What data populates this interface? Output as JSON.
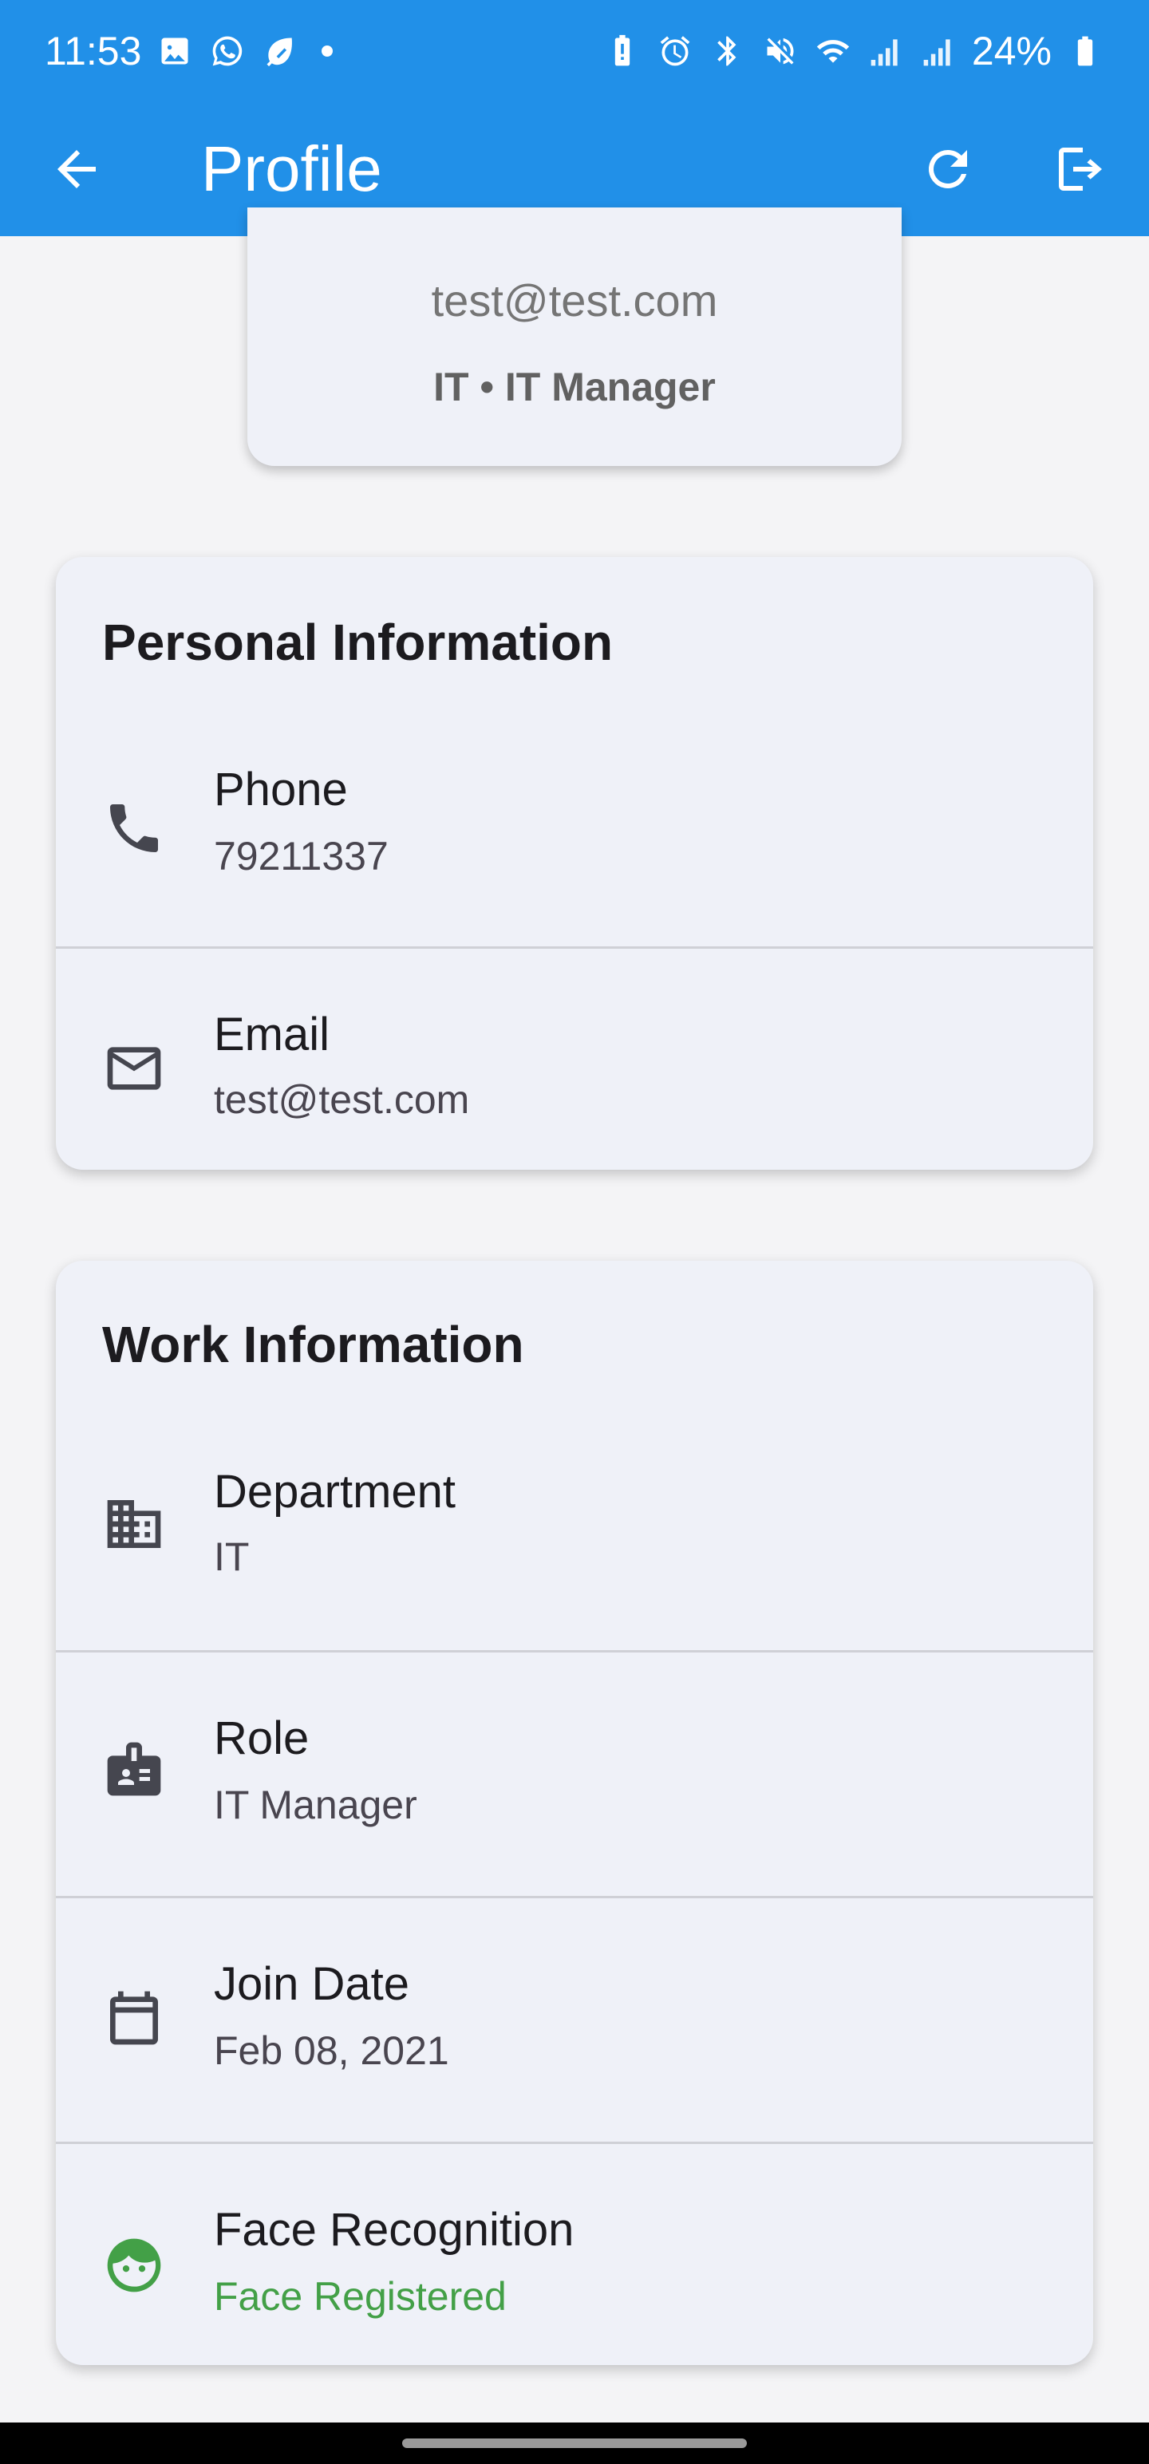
{
  "status_bar": {
    "time": "11:53",
    "battery": "24%",
    "left_icons": [
      "gallery-icon",
      "whatsapp-icon",
      "leaf-icon"
    ],
    "right_icons": [
      "battery-saver-icon",
      "alarm-icon",
      "bluetooth-icon",
      "mute-icon",
      "wifi-icon",
      "signal-icon",
      "signal-icon",
      "battery-icon"
    ]
  },
  "app_bar": {
    "title": "Profile",
    "color": "#2190e8"
  },
  "profile_card": {
    "email": "test@test.com",
    "subtitle": "IT • IT Manager"
  },
  "personal": {
    "title": "Personal Information",
    "rows": [
      {
        "icon": "phone-icon",
        "label": "Phone",
        "value": "79211337"
      },
      {
        "icon": "mail-icon",
        "label": "Email",
        "value": "test@test.com"
      }
    ]
  },
  "work": {
    "title": "Work Information",
    "rows": [
      {
        "icon": "building-icon",
        "label": "Department",
        "value": "IT"
      },
      {
        "icon": "badge-icon",
        "label": "Role",
        "value": "IT Manager"
      },
      {
        "icon": "calendar-icon",
        "label": "Join Date",
        "value": "Feb 08, 2021"
      },
      {
        "icon": "face-icon",
        "label": "Face Recognition",
        "value": "Face Registered",
        "accent": "#43a047"
      }
    ]
  }
}
